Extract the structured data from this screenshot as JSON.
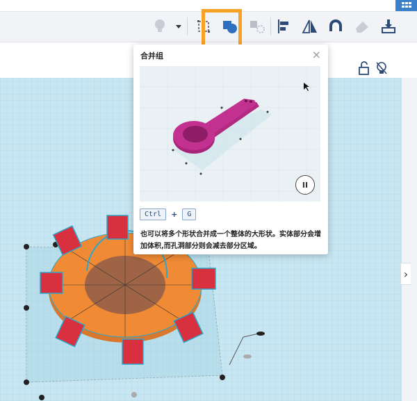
{
  "toolbar": {
    "icons": [
      "lightbulb-icon",
      "dropdown-arrow-icon",
      "group-icon",
      "merge-icon",
      "ungroup-icon",
      "align-icon",
      "mirror-icon",
      "magnet-icon",
      "eraser-icon",
      "import-icon"
    ]
  },
  "popup": {
    "title": "合并组",
    "close": "×",
    "shortcut_key1": "Ctrl",
    "shortcut_plus": "+",
    "shortcut_key2": "G",
    "description": "也可以将多个形状合并成一个整体的大形状。实体部分会增加体积,而孔洞部分则会减去部分区域。",
    "pause": "II"
  },
  "side_panel": {
    "chevron": "›"
  },
  "colors": {
    "accent": "#3a7fc9",
    "highlight": "#f7a225",
    "workplane": "#bfe2ef",
    "shape_orange": "#f08a35",
    "shape_red": "#d93040",
    "spoon_magenta": "#c2318f"
  }
}
